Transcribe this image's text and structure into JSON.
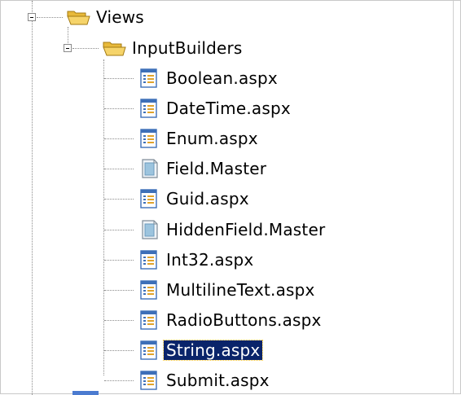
{
  "tree": {
    "root": {
      "label": "Views",
      "icon": "folder-open-icon",
      "expanded": true
    },
    "folder": {
      "label": "InputBuilders",
      "icon": "folder-open-icon",
      "expanded": true
    },
    "files": [
      {
        "label": "Boolean.aspx",
        "icon": "aspx-page-icon"
      },
      {
        "label": "DateTime.aspx",
        "icon": "aspx-page-icon"
      },
      {
        "label": "Enum.aspx",
        "icon": "aspx-page-icon"
      },
      {
        "label": "Field.Master",
        "icon": "master-page-icon"
      },
      {
        "label": "Guid.aspx",
        "icon": "aspx-page-icon"
      },
      {
        "label": "HiddenField.Master",
        "icon": "master-page-icon"
      },
      {
        "label": "Int32.aspx",
        "icon": "aspx-page-icon"
      },
      {
        "label": "MultilineText.aspx",
        "icon": "aspx-page-icon"
      },
      {
        "label": "RadioButtons.aspx",
        "icon": "aspx-page-icon"
      },
      {
        "label": "String.aspx",
        "icon": "aspx-page-icon",
        "selected": true
      },
      {
        "label": "Submit.aspx",
        "icon": "aspx-page-icon"
      }
    ]
  },
  "colors": {
    "selection_bg": "#0a246a",
    "selection_text": "#ffffff",
    "folder": "#f2cc55",
    "aspx_blue": "#3d6fb8"
  }
}
